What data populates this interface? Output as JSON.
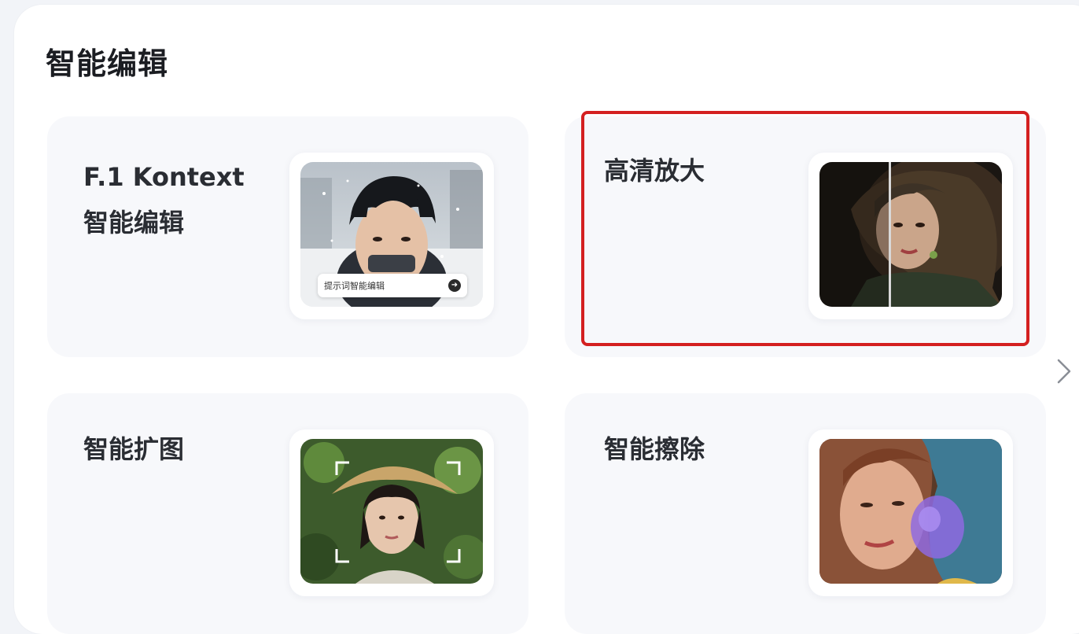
{
  "section": {
    "title": "智能编辑"
  },
  "cards": [
    {
      "lines": [
        "F.1 Kontext",
        "智能编辑"
      ],
      "image": "portrait-snow-man",
      "prompt_overlay": "提示词智能编辑",
      "prompt_send_icon": "send-arrow-icon"
    },
    {
      "lines": [
        "高清放大"
      ],
      "image": "portrait-painted-woman-split-comparison",
      "highlighted": true,
      "highlight_color": "#d42020"
    },
    {
      "lines": [
        "智能扩图"
      ],
      "image": "portrait-woman-straw-hat-with-crop-corners"
    },
    {
      "lines": [
        "智能擦除"
      ],
      "image": "portrait-woman-headscarf-with-erase-mark"
    }
  ],
  "navigation": {
    "next_icon": "chevron-right-icon"
  }
}
